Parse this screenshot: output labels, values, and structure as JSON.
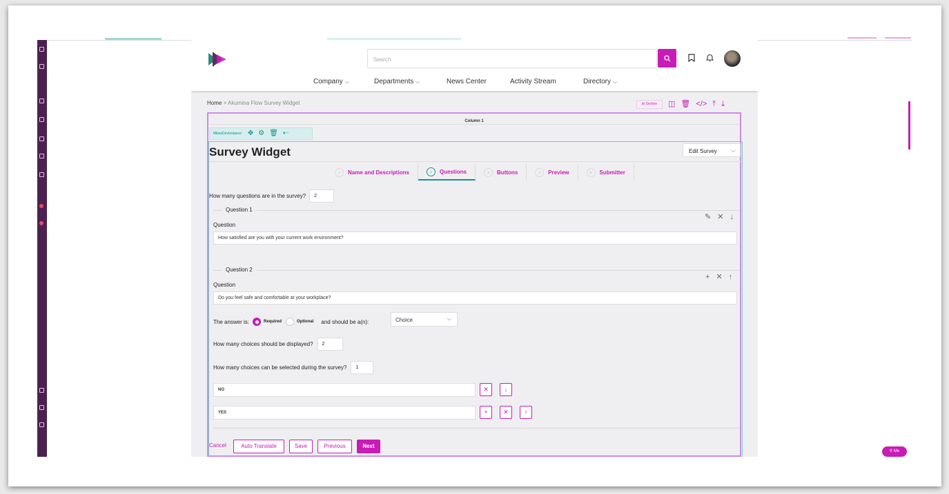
{
  "app": {
    "search": {
      "placeholder": "Search"
    },
    "nav": [
      {
        "label": "Company",
        "has_dropdown": true
      },
      {
        "label": "Departments",
        "has_dropdown": true
      },
      {
        "label": "News Center",
        "has_dropdown": false
      },
      {
        "label": "Activity Stream",
        "has_dropdown": false
      },
      {
        "label": "Directory",
        "has_dropdown": true
      }
    ],
    "icons": {
      "logo": "logo-icon",
      "search": "search-icon",
      "bookmark": "bookmark-icon",
      "notifications": "bell-icon",
      "avatar": "avatar"
    },
    "me_chip": "Me"
  },
  "breadcrumb": {
    "home": "Home",
    "separator": ">",
    "current": "Akumina Flow Survey Widget"
  },
  "toolbar": {
    "section_label": "Section",
    "icons": [
      "columns-icon",
      "trash-icon",
      "code-icon",
      "align-top-icon",
      "align-bottom-icon"
    ]
  },
  "column": {
    "title": "Column 1"
  },
  "instance": {
    "label": "MikesDevInstance",
    "icons": [
      "move-icon",
      "settings-icon",
      "trash-icon",
      "exit-icon"
    ]
  },
  "widget": {
    "title": "Survey Widget",
    "edit_select": "Edit Survey",
    "steps": [
      {
        "num": "1",
        "label": "Name and Descriptions",
        "active": false
      },
      {
        "num": "2",
        "label": "Questions",
        "active": true
      },
      {
        "num": "3",
        "label": "Buttons",
        "active": false
      },
      {
        "num": "4",
        "label": "Preview",
        "active": false
      },
      {
        "num": "5",
        "label": "Submitter",
        "active": false
      }
    ],
    "question_count_label": "How many questions are in the survey?",
    "question_count": "2",
    "questions": [
      {
        "legend": "Question 1",
        "field_label": "Question",
        "text": "How satisfied are you with your current work environment?"
      },
      {
        "legend": "Question 2",
        "field_label": "Question",
        "text": "Do you feel safe and comfortable at your workplace?",
        "answer_label": "The answer is:",
        "required_label": "Required",
        "optional_label": "Optional",
        "required": true,
        "type_label": "and should be a(n):",
        "type_value": "Choice",
        "choices_displayed_label": "How many choices should be displayed?",
        "choices_displayed": "2",
        "choices_selectable_label": "How many choices can be selected during the survey?",
        "choices_selectable": "1",
        "choices": [
          "NO",
          "YES"
        ]
      }
    ],
    "buttons": {
      "cancel": "Cancel",
      "auto_translate": "Auto Translate",
      "save": "Save",
      "previous": "Previous",
      "next": "Next"
    }
  },
  "colors": {
    "accent": "#c91bb6",
    "teal": "#17918c",
    "rail": "#4b2150"
  }
}
